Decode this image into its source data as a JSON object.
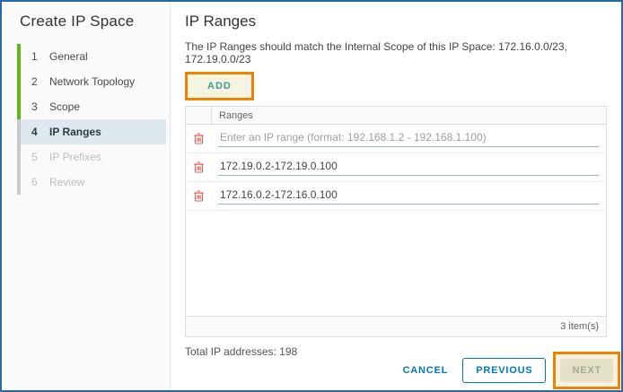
{
  "window": {
    "title": "Create IP Space"
  },
  "sidebar": {
    "steps": [
      {
        "number": "1",
        "label": "General",
        "state": "done"
      },
      {
        "number": "2",
        "label": "Network Topology",
        "state": "done"
      },
      {
        "number": "3",
        "label": "Scope",
        "state": "done"
      },
      {
        "number": "4",
        "label": "IP Ranges",
        "state": "active"
      },
      {
        "number": "5",
        "label": "IP Prefixes",
        "state": "disabled"
      },
      {
        "number": "6",
        "label": "Review",
        "state": "disabled"
      }
    ]
  },
  "main": {
    "title": "IP Ranges",
    "description": "The IP Ranges should match the Internal Scope of this IP Space: 172.16.0.0/23, 172.19.0.0/23",
    "add_button_label": "ADD",
    "table": {
      "header": "Ranges",
      "rows": [
        {
          "value": "",
          "placeholder": "Enter an IP range (format: 192.168.1.2 - 192.168.1.100)"
        },
        {
          "value": "172.19.0.2-172.19.0.100"
        },
        {
          "value": "172.16.0.2-172.16.0.100"
        }
      ],
      "footer_count": "3 item(s)"
    },
    "total_label": "Total IP addresses: 198",
    "buttons": {
      "cancel": "CANCEL",
      "previous": "PREVIOUS",
      "next": "NEXT"
    }
  },
  "colors": {
    "window_border": "#2a68a5",
    "step_done_bar": "#61b715",
    "step_rest_bar": "#c9c9c9",
    "active_step_bg": "#dde9ef",
    "annotation_orange": "#ef8200",
    "add_text": "#3c9e96",
    "action_blue": "#0079b8",
    "trash_red": "#e0614f"
  }
}
